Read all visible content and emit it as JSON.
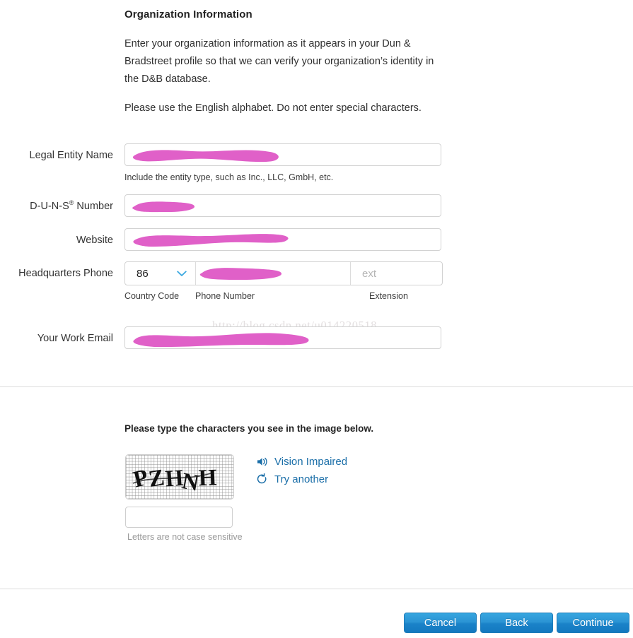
{
  "section": {
    "heading": "Organization Information",
    "intro_paragraph_1": "Enter your organization information as it appears in your Dun & Bradstreet profile so that we can verify your organization’s identity in the D&B database.",
    "intro_paragraph_2": "Please use the English alphabet. Do not enter special characters."
  },
  "form": {
    "legal_entity_name": {
      "label": "Legal Entity Name",
      "value": "",
      "redacted": true,
      "helper": "Include the entity type, such as Inc., LLC, GmbH, etc."
    },
    "duns_number": {
      "label_prefix": "D-U-N-S",
      "label_mark": "®",
      "label_suffix": " Number",
      "value": "",
      "redacted": true
    },
    "website": {
      "label": "Website",
      "value": "",
      "redacted": true
    },
    "headquarters_phone": {
      "label": "Headquarters Phone",
      "country_code_value": "86",
      "country_code_sublabel": "Country Code",
      "phone_number_value": "",
      "phone_number_sublabel": "Phone Number",
      "extension_placeholder": "ext",
      "extension_value": "",
      "extension_sublabel": "Extension",
      "redacted": true
    },
    "work_email": {
      "label": "Your Work Email",
      "value": "",
      "redacted": true
    }
  },
  "captcha": {
    "prompt": "Please type the characters you see in the image below.",
    "image_characters": "PZHNH",
    "input_value": "",
    "note": "Letters are not case sensitive",
    "vision_impaired_label": "Vision Impaired",
    "try_another_label": "Try another"
  },
  "footer": {
    "cancel_label": "Cancel",
    "back_label": "Back",
    "continue_label": "Continue"
  },
  "watermark": {
    "text": "http://blog.csdn.net/u014220518"
  },
  "colors": {
    "link_blue": "#1a6ea8",
    "button_blue": "#2b94d4",
    "chevron_blue": "#3aa8e0",
    "redaction_magenta": "#e060c8",
    "divider_gray": "#dddddd",
    "input_border": "#d2d2d2",
    "placeholder_gray": "#b5b5b5",
    "watermark_gray": "#e3dfe0"
  }
}
